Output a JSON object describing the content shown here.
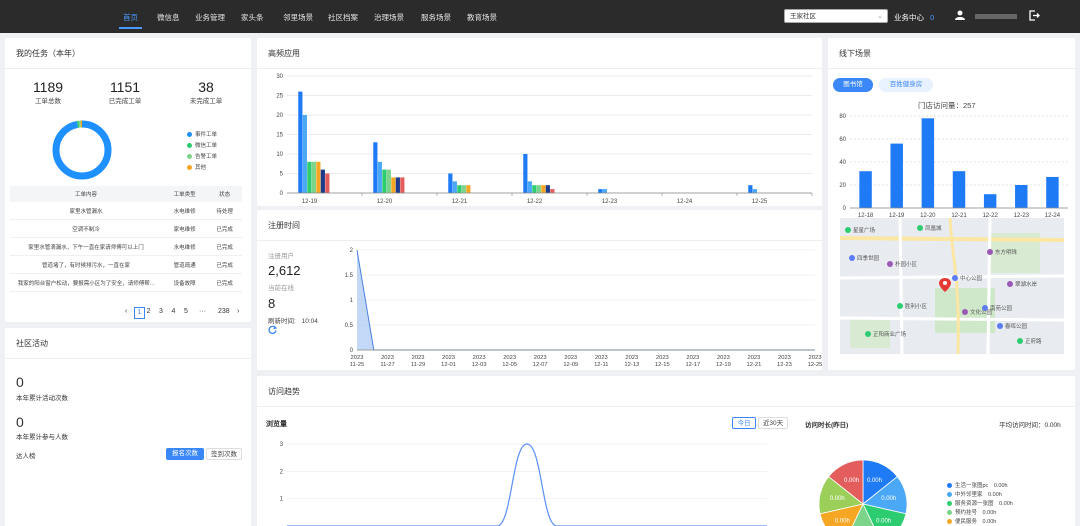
{
  "nav": {
    "items": [
      "首页",
      "微信息",
      "业务管理",
      "家头条",
      "邻里场景",
      "社区档案",
      "治理场景",
      "服务场景",
      "教育场景"
    ],
    "active_index": 0,
    "region_select": "王家社区",
    "business_center_label": "业务中心",
    "business_center_count": "0",
    "icons": {
      "chevron": "chevron-down-icon",
      "user": "user-icon",
      "logout": "logout-icon"
    }
  },
  "my_tasks": {
    "title": "我的任务（本年）",
    "stats": [
      {
        "value": "1189",
        "label": "工单总数"
      },
      {
        "value": "1151",
        "label": "已完成工单"
      },
      {
        "value": "38",
        "label": "未完成工单"
      }
    ],
    "donut": {
      "segments": [
        {
          "name": "事件工单",
          "value": 0.97,
          "color": "#1e90ff"
        },
        {
          "name": "微信工单",
          "value": 0.01,
          "color": "#2ecc71"
        },
        {
          "name": "告警工单",
          "value": 0.01,
          "color": "#7bd48a"
        },
        {
          "name": "其他",
          "value": 0.01,
          "color": "#f5a623"
        }
      ]
    },
    "table": {
      "headers": [
        "工单内容",
        "工单类型",
        "状态"
      ],
      "rows": [
        [
          "家里水管漏水",
          "水电维修",
          "待处理"
        ],
        [
          "空调不制冷",
          "家电维修",
          "已完成"
        ],
        [
          "家里水管滴漏水，下午一直在家请师傅可以上门",
          "水电维修",
          "已完成"
        ],
        [
          "管道堵了，有时候排污水，一直在家",
          "管道疏通",
          "已完成"
        ],
        [
          "我家的阳台窗户松动，要报需小区为了安全，请师傅帮...",
          "设备故障",
          "已完成"
        ]
      ]
    },
    "pagination": {
      "prev": "‹",
      "pages": [
        "1",
        "2",
        "3",
        "4",
        "5"
      ],
      "ellipsis": "···",
      "last": "238",
      "next": "›",
      "current": "1"
    }
  },
  "community": {
    "title": "社区活动",
    "stats": [
      {
        "value": "0",
        "label": "本年累计活动次数"
      },
      {
        "value": "0",
        "label": "本年累计参与人数"
      }
    ],
    "expert_label": "达人榜",
    "tabs": [
      "报名次数",
      "签到次数"
    ],
    "active_tab": 0
  },
  "freq_apps": {
    "title": "高频应用",
    "chart_data": {
      "type": "bar",
      "categories": [
        "12-19",
        "12-20",
        "12-21",
        "12-22",
        "12-23",
        "12-24",
        "12-25"
      ],
      "yticks": [
        "0",
        "5",
        "10",
        "15",
        "20",
        "25",
        "30"
      ],
      "ylim": [
        0,
        30
      ],
      "series_colors": [
        "#1e7bf5",
        "#4aa8f7",
        "#2ecc71",
        "#7bd48a",
        "#f5a623",
        "#1e3a8a",
        "#e35d5d"
      ],
      "series": [
        {
          "values": [
            26,
            13,
            5,
            10,
            1,
            0,
            2
          ]
        },
        {
          "values": [
            20,
            8,
            3,
            3,
            1,
            0,
            1
          ]
        },
        {
          "values": [
            8,
            6,
            2,
            2,
            0,
            0,
            0
          ]
        },
        {
          "values": [
            8,
            6,
            2,
            2,
            0,
            0,
            0
          ]
        },
        {
          "values": [
            8,
            4,
            2,
            2,
            0,
            0,
            0
          ]
        },
        {
          "values": [
            6,
            4,
            0,
            2,
            0,
            0,
            0
          ]
        },
        {
          "values": [
            5,
            4,
            0,
            1,
            0,
            0,
            0
          ]
        }
      ]
    }
  },
  "register": {
    "title": "注册时间",
    "users_label": "注册用户",
    "users_value": "2,612",
    "online_label": "当前在线",
    "online_value": "8",
    "refresh_label": "刷新时间:",
    "refresh_time": "10:04",
    "chart_data": {
      "type": "area",
      "yticks": [
        "0",
        "0.5",
        "1",
        "1.5",
        "2"
      ],
      "ylim": [
        0,
        2
      ],
      "x": [
        "2023 11-25",
        "2023 11-27",
        "2023 11-29",
        "2023 12-01",
        "2023 12-03",
        "2023 12-05",
        "2023 12-07",
        "2023 12-09",
        "2023 12-11",
        "2023 12-13",
        "2023 12-15",
        "2023 12-17",
        "2023 12-19",
        "2023 12-21",
        "2023 12-23",
        "2023 12-25"
      ],
      "values": [
        2,
        0,
        0,
        0,
        0,
        0,
        0,
        0,
        0,
        0,
        0,
        0,
        0,
        0,
        0,
        0
      ]
    }
  },
  "offline": {
    "title": "线下场景",
    "tabs": [
      "图书馆",
      "百姓健身房"
    ],
    "active_tab": 0,
    "visits_label": "门店访问量：257",
    "chart_data": {
      "type": "bar",
      "categories": [
        "12-18",
        "12-19",
        "12-20",
        "12-21",
        "12-22",
        "12-23",
        "12-24"
      ],
      "values": [
        32,
        56,
        78,
        32,
        12,
        20,
        27
      ],
      "yticks": [
        "0",
        "20",
        "40",
        "60",
        "80"
      ],
      "ylim": [
        0,
        80
      ],
      "color": "#1e7bf5"
    },
    "map_labels": [
      "星星广场",
      "四季世园",
      "朴园小区",
      "凤凰城",
      "中心公园",
      "东方明珠",
      "正阳商业广场",
      "春晖公园",
      "翠湖水岸",
      "胜利小区",
      "南苑公园",
      "文化公园",
      "正府路"
    ]
  },
  "visit_trend": {
    "title": "访问趋势",
    "pv_label": "浏览量",
    "range_tabs": [
      "今日",
      "近30天"
    ],
    "active_range": 0,
    "duration_label": "访问时长(昨日)",
    "avg_label": "平均访问时间：0.00h",
    "chart_data": {
      "type": "line",
      "yticks": [
        "0",
        "1",
        "2",
        "3"
      ],
      "ylim": [
        0,
        3
      ],
      "values": [
        0,
        0,
        0,
        0,
        0,
        0,
        0,
        0,
        3,
        0,
        0,
        0,
        0,
        0,
        0,
        0,
        0
      ]
    },
    "pie": {
      "slices": [
        {
          "name": "生活一张图pc",
          "value": "0.00h",
          "color": "#1e7bf5"
        },
        {
          "name": "中外邻里家",
          "value": "0.00h",
          "color": "#4aa8f7"
        },
        {
          "name": "服务资源一张图",
          "value": "0.00h",
          "color": "#2ecc71"
        },
        {
          "name": "预约挂号",
          "value": "0.00h",
          "color": "#7bd48a"
        },
        {
          "name": "便民服务",
          "value": "0.00h",
          "color": "#f5a623"
        },
        {
          "name": "邻里互助",
          "value": "0.00h",
          "color": "#9ccf5a"
        },
        {
          "name": "社区公告",
          "value": "0.00h",
          "color": "#e35d5d"
        }
      ]
    }
  }
}
